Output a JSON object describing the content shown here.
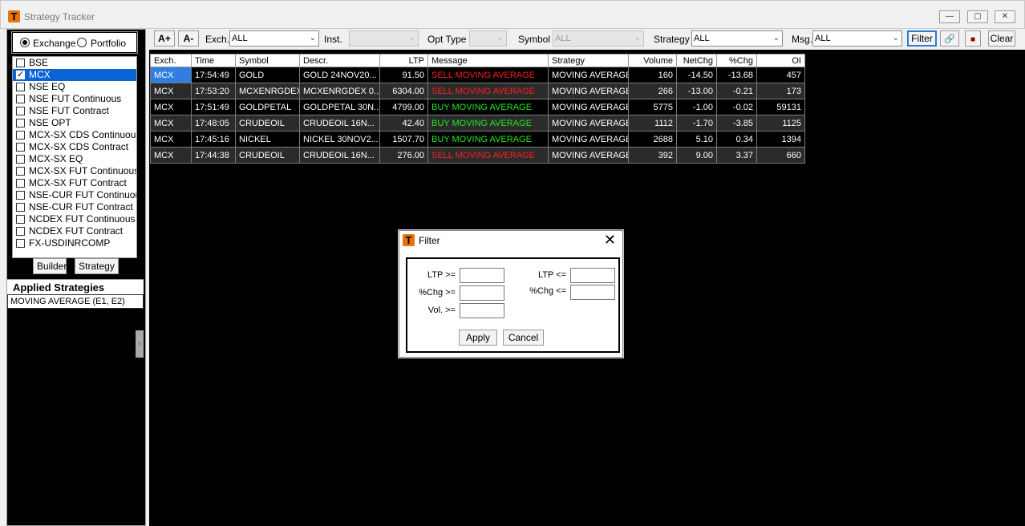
{
  "window": {
    "title": "Strategy Tracker",
    "controls": [
      "—",
      "▢",
      "✕"
    ]
  },
  "left": {
    "radio": {
      "exchange": "Exchange",
      "portfolio": "Portfolio",
      "selected": "exchange"
    },
    "exchanges": [
      {
        "label": "BSE",
        "checked": false
      },
      {
        "label": "MCX",
        "checked": true
      },
      {
        "label": "NSE EQ",
        "checked": false
      },
      {
        "label": "NSE FUT Continuous",
        "checked": false
      },
      {
        "label": "NSE FUT Contract",
        "checked": false
      },
      {
        "label": "NSE OPT",
        "checked": false
      },
      {
        "label": "MCX-SX CDS Continuous",
        "checked": false
      },
      {
        "label": "MCX-SX CDS Contract",
        "checked": false
      },
      {
        "label": "MCX-SX EQ",
        "checked": false
      },
      {
        "label": "MCX-SX FUT Continuous",
        "checked": false
      },
      {
        "label": "MCX-SX FUT Contract",
        "checked": false
      },
      {
        "label": "NSE-CUR FUT Continuous",
        "checked": false
      },
      {
        "label": "NSE-CUR FUT Contract",
        "checked": false
      },
      {
        "label": "NCDEX FUT Continuous",
        "checked": false
      },
      {
        "label": "NCDEX FUT Contract",
        "checked": false
      },
      {
        "label": "FX-USDINRCOMP",
        "checked": false
      }
    ],
    "builder_label": "Builder",
    "strategy_label": "Strategy",
    "applied_title": "Applied Strategies",
    "applied_item": "MOVING AVERAGE (E1, E2)",
    "collapse_glyph": "‹"
  },
  "toolbar": {
    "font_up": "A+",
    "font_down": "A-",
    "exch_label": "Exch.",
    "exch_value": "ALL",
    "inst_label": "Inst.",
    "inst_value": "",
    "opt_label": "Opt Type",
    "opt_value": "",
    "symbol_label": "Symbol",
    "symbol_value": "ALL",
    "strategy_label": "Strategy",
    "strategy_value": "ALL",
    "msg_label": "Msg.",
    "msg_value": "ALL",
    "filter_label": "Filter",
    "clear_label": "Clear",
    "link_icon": "🔗",
    "stop_icon": "■"
  },
  "grid": {
    "columns": [
      "Exch.",
      "Time",
      "Symbol",
      "Descr.",
      "LTP",
      "Message",
      "Strategy",
      "Volume",
      "NetChg",
      "%Chg",
      "OI"
    ],
    "rows": [
      {
        "exch": "MCX",
        "time": "17:54:49",
        "symbol": "GOLD",
        "descr": "GOLD 24NOV20...",
        "ltp": "91.50",
        "message": "SELL MOVING AVERAGE",
        "type": "sell",
        "strategy": "MOVING AVERAGE",
        "volume": "160",
        "netchg": "-14.50",
        "pchg": "-13.68",
        "oi": "457"
      },
      {
        "exch": "MCX",
        "time": "17:53:20",
        "symbol": "MCXENRGDEX",
        "descr": "MCXENRGDEX 0...",
        "ltp": "6304.00",
        "message": "SELL MOVING AVERAGE",
        "type": "sell",
        "strategy": "MOVING AVERAGE",
        "volume": "266",
        "netchg": "-13.00",
        "pchg": "-0.21",
        "oi": "173"
      },
      {
        "exch": "MCX",
        "time": "17:51:49",
        "symbol": "GOLDPETAL",
        "descr": "GOLDPETAL 30N...",
        "ltp": "4799.00",
        "message": "BUY MOVING AVERAGE",
        "type": "buy",
        "strategy": "MOVING AVERAGE",
        "volume": "5775",
        "netchg": "-1.00",
        "pchg": "-0.02",
        "oi": "59131"
      },
      {
        "exch": "MCX",
        "time": "17:48:05",
        "symbol": "CRUDEOIL",
        "descr": "CRUDEOIL 16N...",
        "ltp": "42.40",
        "message": "BUY MOVING AVERAGE",
        "type": "buy",
        "strategy": "MOVING AVERAGE",
        "volume": "1112",
        "netchg": "-1.70",
        "pchg": "-3.85",
        "oi": "1125"
      },
      {
        "exch": "MCX",
        "time": "17:45:16",
        "symbol": "NICKEL",
        "descr": "NICKEL 30NOV2...",
        "ltp": "1507.70",
        "message": "BUY MOVING AVERAGE",
        "type": "buy",
        "strategy": "MOVING AVERAGE",
        "volume": "2688",
        "netchg": "5.10",
        "pchg": "0.34",
        "oi": "1394"
      },
      {
        "exch": "MCX",
        "time": "17:44:38",
        "symbol": "CRUDEOIL",
        "descr": "CRUDEOIL 16N...",
        "ltp": "276.00",
        "message": "SELL MOVING AVERAGE",
        "type": "sell",
        "strategy": "MOVING AVERAGE",
        "volume": "392",
        "netchg": "9.00",
        "pchg": "3.37",
        "oi": "660"
      }
    ]
  },
  "dialog": {
    "title": "Filter",
    "close": "✕",
    "ltp_ge": "LTP >=",
    "ltp_le": "LTP <=",
    "chg_ge": "%Chg >=",
    "chg_le": "%Chg <=",
    "vol_ge": "Vol. >=",
    "apply": "Apply",
    "cancel": "Cancel",
    "values": {
      "ltp_ge": "",
      "ltp_le": "",
      "chg_ge": "",
      "chg_le": "",
      "vol_ge": ""
    }
  },
  "colors": {
    "sell": "#ff1e1e",
    "buy": "#22e822",
    "selection": "#2f7ee0",
    "accent": "#e8720c"
  }
}
